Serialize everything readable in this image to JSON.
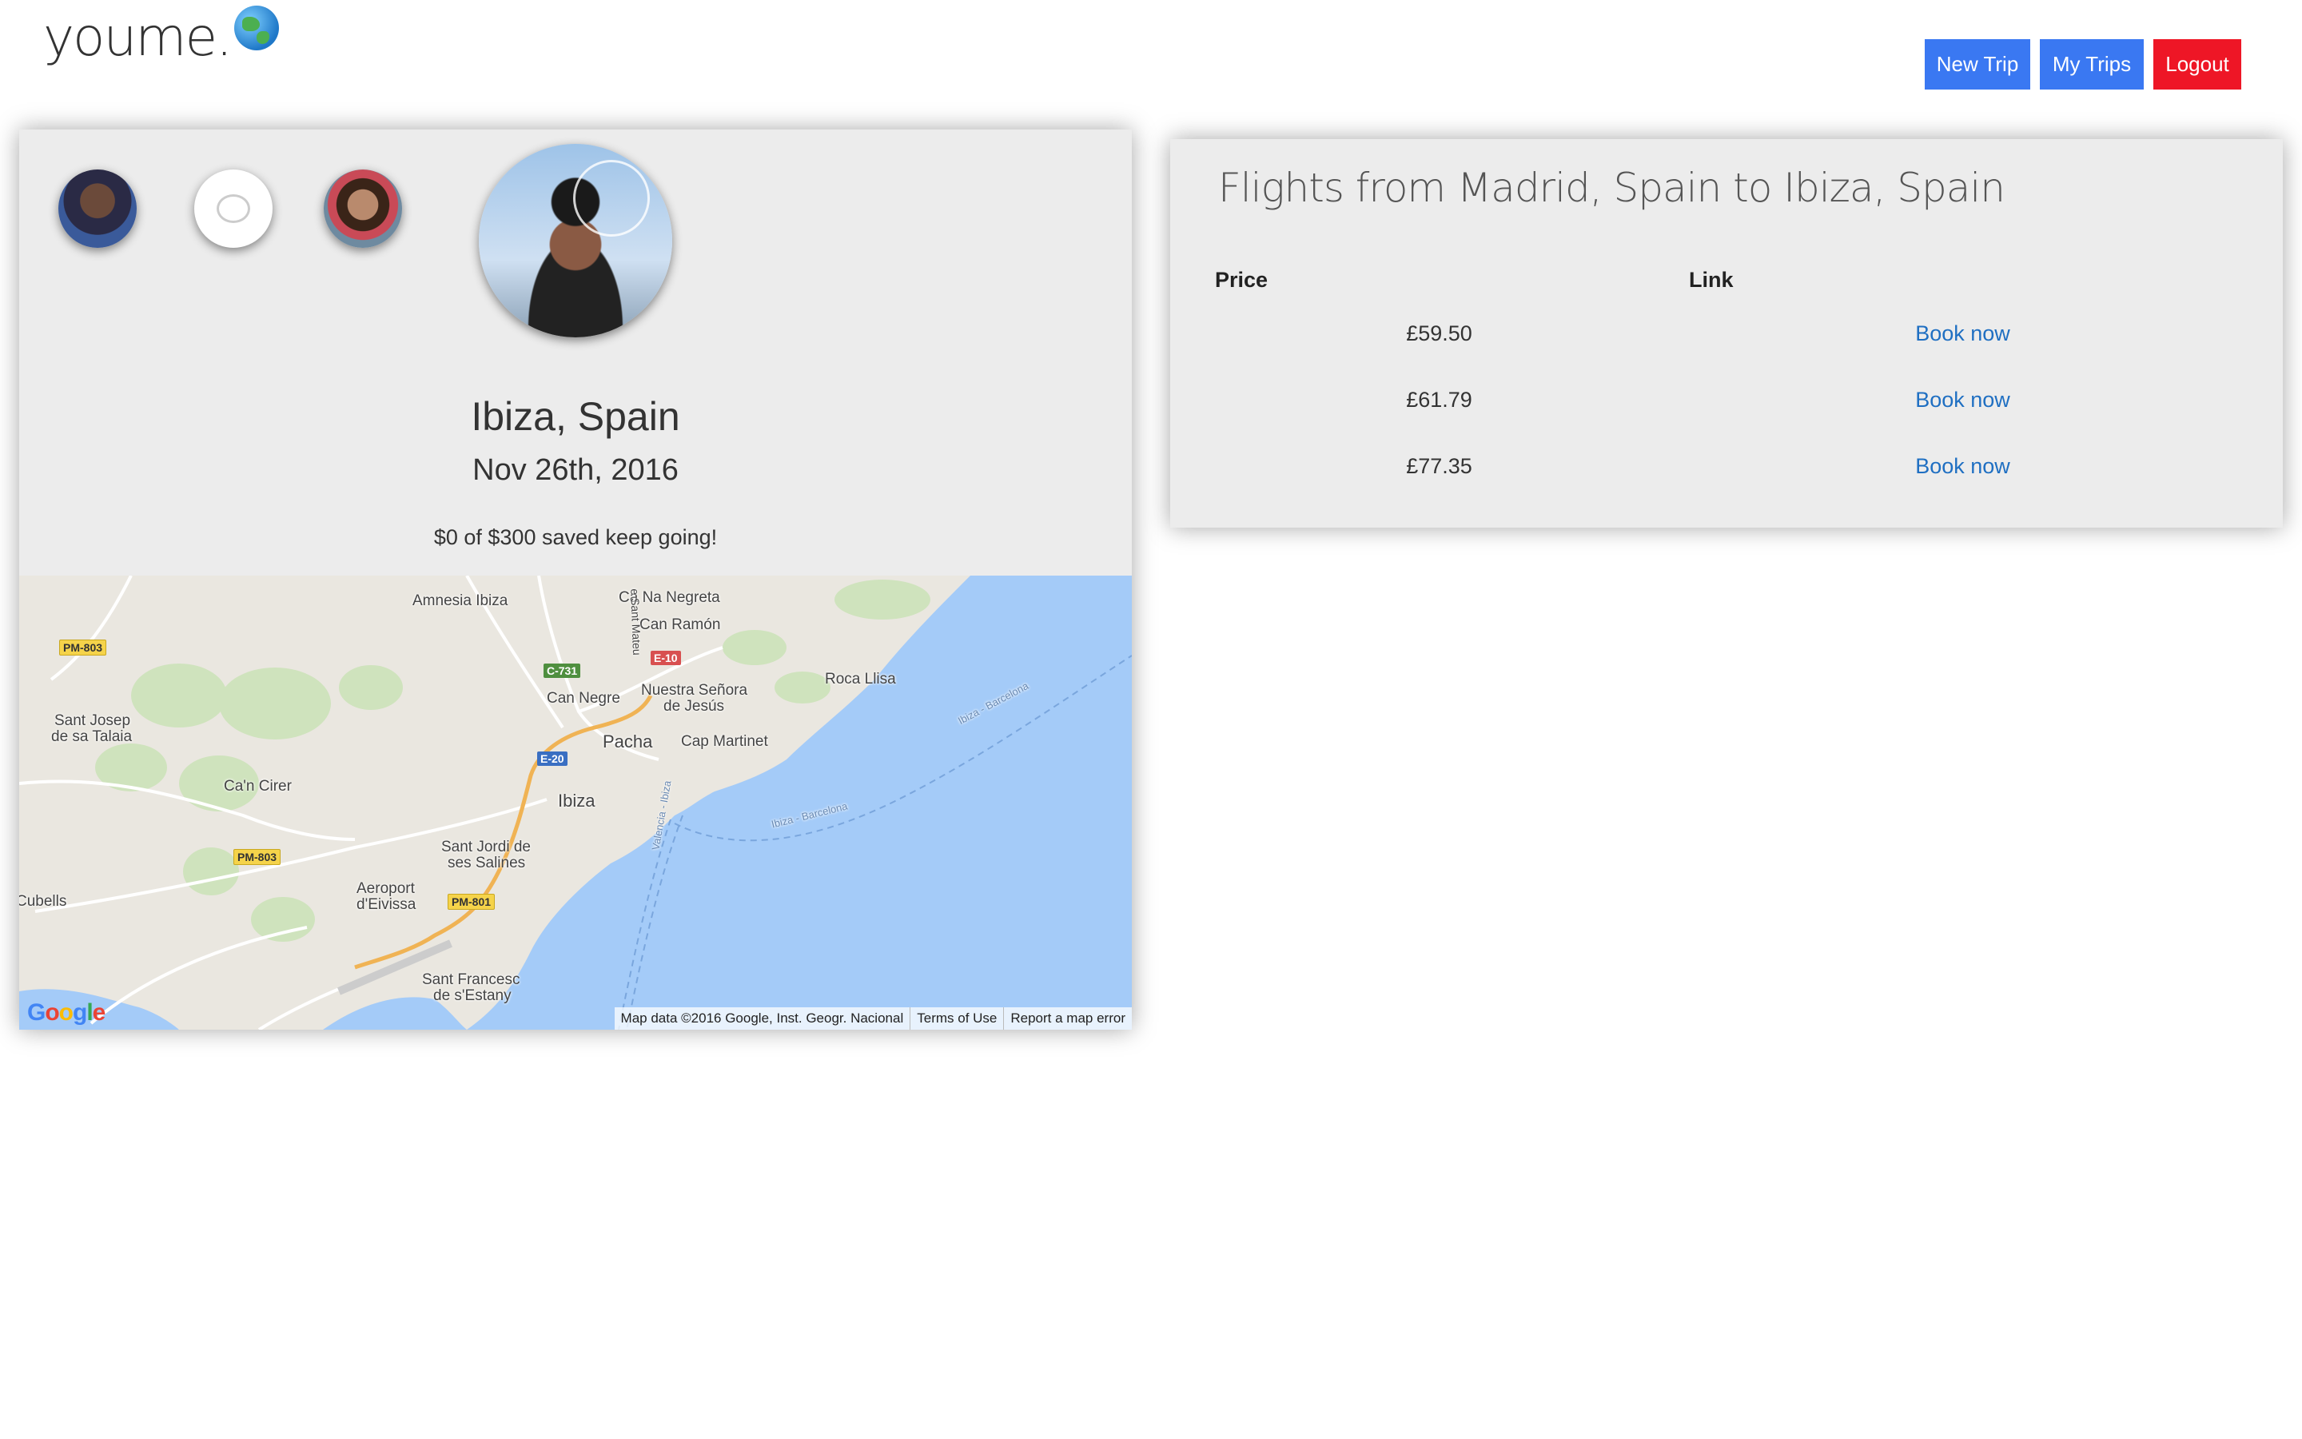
{
  "brand": {
    "name": "youme.",
    "icon": "globe-icon"
  },
  "nav": {
    "new_trip": "New Trip",
    "my_trips": "My Trips",
    "logout": "Logout"
  },
  "colors": {
    "nav_blue": "#3a78f2",
    "logout_red": "#ee1626",
    "link_blue": "#1f6fc2",
    "card_bg": "#ececec"
  },
  "trip": {
    "destination": "Ibiza, Spain",
    "date": "Nov 26th, 2016",
    "savings": "$0 of $300 saved keep going!"
  },
  "map": {
    "labels": {
      "amnesia": "Amnesia Ibiza",
      "ca_na_negreta": "Ca Na Negreta",
      "can_ramon": "Can Ramón",
      "sant_mateu": "e Sant Mateu",
      "roca_llisa": "Roca Llisa",
      "nuestra": "Nuestra Señora",
      "de_jesus": "de Jesús",
      "can_negre": "Can Negre",
      "pacha": "Pacha",
      "cap_martinet": "Cap Martinet",
      "sant_josep": "Sant Josep",
      "de_sa_talaia": "de sa Talaia",
      "can_cirer": "Ca'n Cirer",
      "ibiza": "Ibiza",
      "sant_jordi": "Sant Jordi de",
      "ses_salines": "ses Salines",
      "aeroport": "Aeroport",
      "deivissa": "d'Eivissa",
      "cubells": "Cubells",
      "sant_francesc": "Sant Francesc",
      "de_sestany": "de s'Estany",
      "ferry1": "Ibiza - Barcelona",
      "ferry2": "Ibiza - Barcelona",
      "ferry3": "Valencia - Ibiza"
    },
    "shields": {
      "pm803a": "PM-803",
      "pm803b": "PM-803",
      "c731": "C-731",
      "e10": "E-10",
      "e20": "E-20",
      "pm801": "PM-801"
    },
    "attribution": {
      "data": "Map data ©2016 Google, Inst. Geogr. Nacional",
      "terms": "Terms of Use",
      "report": "Report a map error"
    }
  },
  "flights": {
    "title": "Flights from Madrid, Spain to Ibiza, Spain",
    "columns": [
      "Price",
      "Link"
    ],
    "rows": [
      {
        "price": "£59.50",
        "link": "Book now"
      },
      {
        "price": "£61.79",
        "link": "Book now"
      },
      {
        "price": "£77.35",
        "link": "Book now"
      }
    ]
  }
}
